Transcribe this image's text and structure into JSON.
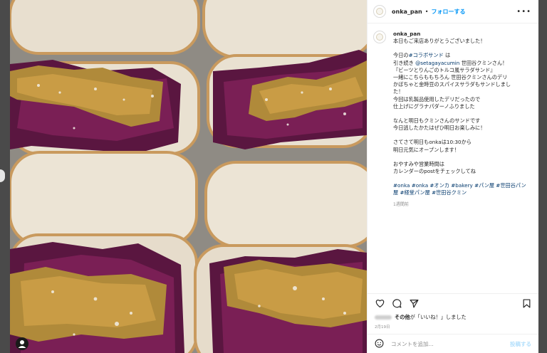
{
  "header": {
    "username": "onka_pan",
    "separator": "•",
    "follow_label": "フォローする",
    "more_icon": "more-horizontal-icon"
  },
  "caption": {
    "username": "onka_pan",
    "lines": [
      "本日もご来店ありがとうございました！",
      "",
      "今日の",
      "引き続き",
      "『ビーツとりんごのトルコ風サラダサンド』",
      "一緒にこちらももちろん 世田谷クミンさんのデリ",
      "かぼちゃと金時豆のスパイスサラダもサンドしまし",
      "た！",
      "今回は乳製品使用したデリだったので",
      "仕上げにグラナパダーノふりました",
      "",
      "なんと明日もクミンさんのサンドです",
      "今日逃したかたはぜひ明日お楽しみに！",
      "",
      "さてさて明日もonkaは10:30から",
      "明日元気にオープンします！",
      "",
      "おやすみや営業時間は",
      "カレンダーのpostをチェックしてね"
    ],
    "hashtag_collab": "#コラボサンド",
    "collab_suffix": "は",
    "mention": "@setagayacumin",
    "mention_suffix": "世田谷クミンさん！",
    "tags": "#onka #onka #オンカ #bakery #パン屋 #世田谷パン屋 #経堂パン屋 #世田谷クミン",
    "time_ago": "1週間前"
  },
  "likes": {
    "text": "その他",
    "suffix": "が「いいね！」しました"
  },
  "date": "2月19日",
  "comment": {
    "placeholder": "コメントを追加...",
    "post_label": "投稿する"
  },
  "icons": [
    "heart-icon",
    "comment-icon",
    "share-icon",
    "bookmark-icon",
    "smile-icon",
    "user-tag-icon"
  ],
  "colors": {
    "link_blue": "#0095f6",
    "hashtag_blue": "#00376b",
    "muted": "#8e8e8e"
  }
}
